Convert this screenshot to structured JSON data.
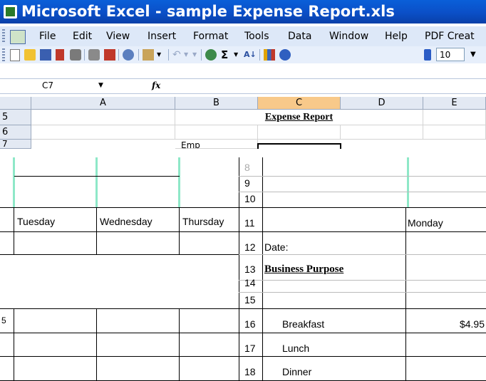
{
  "window": {
    "title": "Microsoft Excel - sample Expense Report.xls"
  },
  "menu": {
    "items": [
      "File",
      "Edit",
      "View",
      "Insert",
      "Format",
      "Tools",
      "Data",
      "Window",
      "Help",
      "PDF Creat"
    ]
  },
  "toolbar": {
    "font_size": "10",
    "sigma": "Σ"
  },
  "formula_bar": {
    "name_box": "C7",
    "fx": "fx"
  },
  "columns": [
    "A",
    "B",
    "C",
    "D",
    "E"
  ],
  "rows_top": [
    {
      "num": "5",
      "title": "Expense Report"
    },
    {
      "num": "6"
    },
    {
      "num": "7",
      "fragment": "Emp"
    }
  ],
  "lower": {
    "row_numbers": [
      "8",
      "9",
      "10",
      "11",
      "12",
      "13",
      "14",
      "15",
      "16",
      "17",
      "18"
    ],
    "day_headers_left": [
      "Tuesday",
      "Wednesday",
      "Thursday"
    ],
    "day_header_right": "Monday",
    "date_label": "Date:",
    "business_purpose": "Business Purpose",
    "expenses": [
      {
        "label": "Breakfast",
        "monday": "$4.95"
      },
      {
        "label": "Lunch",
        "monday": ""
      },
      {
        "label": "Dinner",
        "monday": ""
      }
    ],
    "left_fragment": "5"
  },
  "colors": {
    "title_bar": "#0b4fc7",
    "selected_column": "#f8c98a",
    "grid": "#d3d3d3"
  }
}
